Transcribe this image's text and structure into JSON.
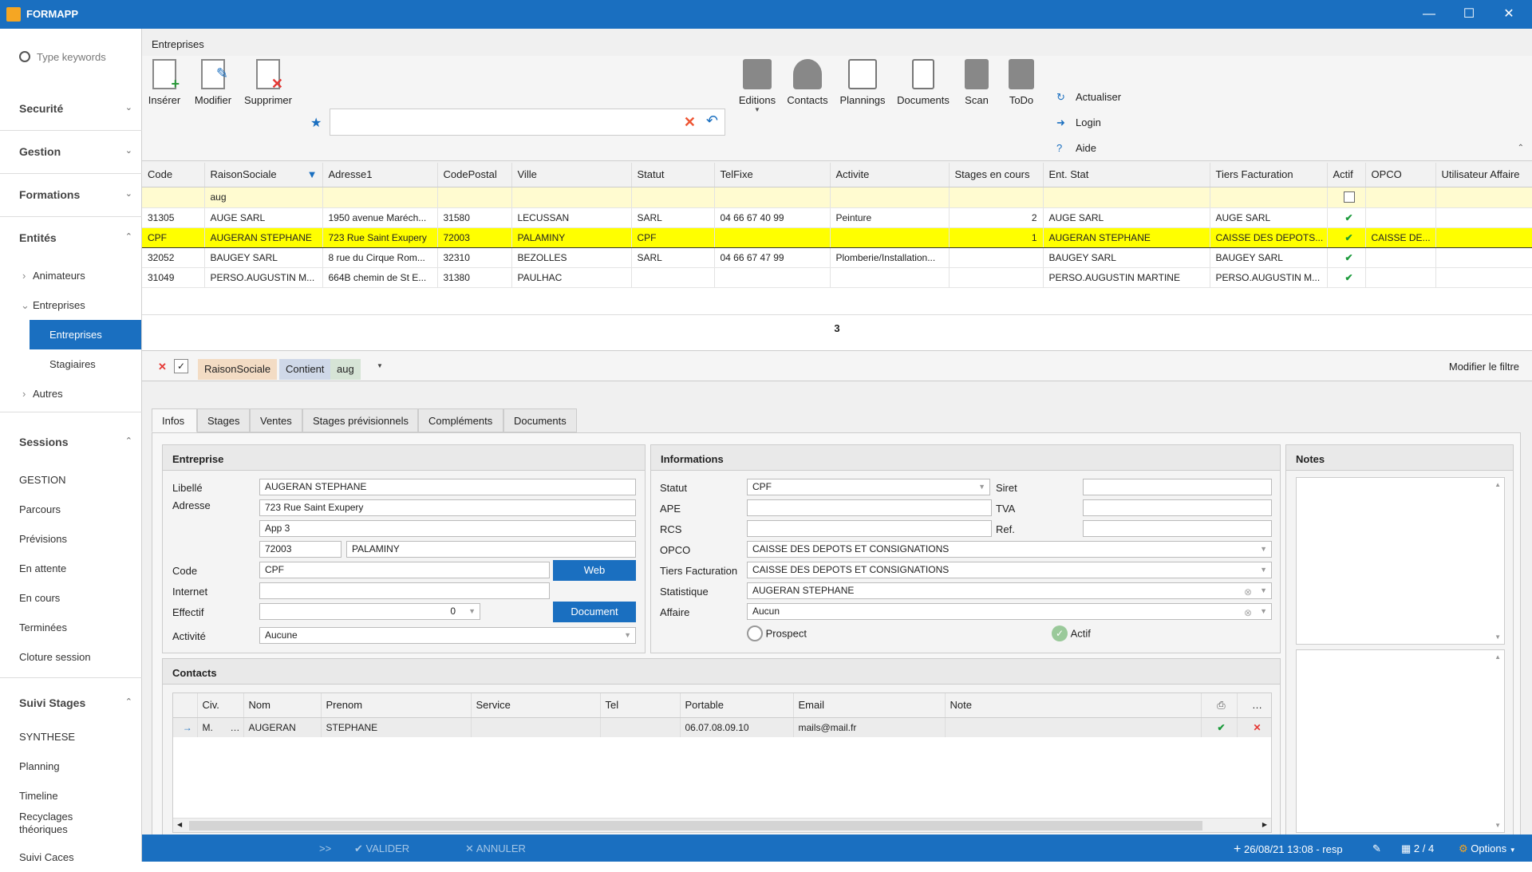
{
  "app": {
    "title": "FORMAPP"
  },
  "sidebar": {
    "search_placeholder": "Type keywords",
    "sections": {
      "securite": "Securité",
      "gestion": "Gestion",
      "formations": "Formations",
      "entites": "Entités",
      "sessions": "Sessions",
      "suivi": "Suivi Stages"
    },
    "entites_items": {
      "animateurs": "Animateurs",
      "entreprises": "Entreprises",
      "entreprises_sub": "Entreprises",
      "stagiaires": "Stagiaires",
      "autres": "Autres"
    },
    "sessions_items": [
      "GESTION",
      "Parcours",
      "Prévisions",
      "En attente",
      "En cours",
      "Terminées",
      "Cloture session"
    ],
    "suivi_items": [
      "SYNTHESE",
      "Planning",
      "Timeline",
      "Recyclages théoriques",
      "Suivi Caces"
    ]
  },
  "breadcrumb": "Entreprises",
  "ribbon": {
    "inserer": "Insérer",
    "modifier": "Modifier",
    "supprimer": "Supprimer",
    "search_value": "",
    "editions": "Editions",
    "contacts": "Contacts",
    "plannings": "Plannings",
    "documents": "Documents",
    "scan": "Scan",
    "todo": "ToDo",
    "actualiser": "Actualiser",
    "login": "Login",
    "aide": "Aide"
  },
  "grid": {
    "columns": [
      "Code",
      "RaisonSociale",
      "Adresse1",
      "CodePostal",
      "Ville",
      "Statut",
      "TelFixe",
      "Activite",
      "Stages en cours",
      "Ent. Stat",
      "Tiers Facturation",
      "Actif",
      "OPCO",
      "Utilisateur Affaire"
    ],
    "filter_value": "aug",
    "rows": [
      {
        "code": "31305",
        "raison": "AUGE SARL",
        "adresse": "1950 avenue Maréch...",
        "cp": "31580",
        "ville": "LECUSSAN",
        "statut": "SARL",
        "tel": "04 66 67 40 99",
        "activite": "Peinture",
        "stages": "2",
        "entstat": "AUGE SARL",
        "tiers": "AUGE SARL",
        "opco": "",
        "util": ""
      },
      {
        "code": "CPF",
        "raison": "AUGERAN STEPHANE",
        "adresse": "723 Rue Saint Exupery",
        "cp": "72003",
        "ville": "PALAMINY",
        "statut": "CPF",
        "tel": "",
        "activite": "",
        "stages": "1",
        "entstat": "AUGERAN STEPHANE",
        "tiers": "CAISSE DES DEPOTS...",
        "opco": "CAISSE DE...",
        "util": ""
      },
      {
        "code": "32052",
        "raison": "BAUGEY SARL",
        "adresse": "8 rue du Cirque Rom...",
        "cp": "32310",
        "ville": "BEZOLLES",
        "statut": "SARL",
        "tel": "04 66 67 47 99",
        "activite": "Plomberie/Installation...",
        "stages": "",
        "entstat": "BAUGEY SARL",
        "tiers": "BAUGEY SARL",
        "opco": "",
        "util": ""
      },
      {
        "code": "31049",
        "raison": "PERSO.AUGUSTIN M...",
        "adresse": "664B chemin de St E...",
        "cp": "31380",
        "ville": "PAULHAC",
        "statut": "",
        "tel": "",
        "activite": "",
        "stages": "",
        "entstat": "PERSO.AUGUSTIN MARTINE",
        "tiers": "PERSO.AUGUSTIN M...",
        "opco": "",
        "util": ""
      }
    ],
    "count": "3"
  },
  "filterbar": {
    "field": "RaisonSociale",
    "op": "Contient",
    "value": "aug",
    "modify": "Modifier le filtre"
  },
  "tabs": [
    "Infos",
    "Stages",
    "Ventes",
    "Stages prévisionnels",
    "Compléments",
    "Documents"
  ],
  "entreprise": {
    "title": "Entreprise",
    "labels": {
      "libelle": "Libellé",
      "adresse": "Adresse",
      "code": "Code",
      "internet": "Internet",
      "effectif": "Effectif",
      "activite": "Activité"
    },
    "libelle": "AUGERAN STEPHANE",
    "adresse1": "723 Rue Saint Exupery",
    "adresse2": "App 3",
    "cp": "72003",
    "ville": "PALAMINY",
    "code": "CPF",
    "internet": "",
    "effectif": "0",
    "activite": "Aucune",
    "web_btn": "Web",
    "doc_btn": "Document"
  },
  "informations": {
    "title": "Informations",
    "labels": {
      "statut": "Statut",
      "ape": "APE",
      "rcs": "RCS",
      "opco": "OPCO",
      "tiers": "Tiers Facturation",
      "statistique": "Statistique",
      "affaire": "Affaire",
      "siret": "Siret",
      "tva": "TVA",
      "ref": "Ref."
    },
    "statut": "CPF",
    "ape": "",
    "rcs": "",
    "opco": "CAISSE DES DEPOTS ET CONSIGNATIONS",
    "tiers": "CAISSE DES DEPOTS ET CONSIGNATIONS",
    "statistique": "AUGERAN STEPHANE",
    "affaire": "Aucun",
    "prospect": "Prospect",
    "actif": "Actif"
  },
  "notes": {
    "title": "Notes"
  },
  "contacts": {
    "title": "Contacts",
    "columns": [
      "Civ.",
      "Nom",
      "Prenom",
      "Service",
      "Tel",
      "Portable",
      "Email",
      "Note"
    ],
    "row": {
      "civ": "M.",
      "nom": "AUGERAN",
      "prenom": "STEPHANE",
      "service": "",
      "tel": "",
      "portable": "06.07.08.09.10",
      "email": "mails@mail.fr",
      "note": ""
    }
  },
  "statusbar": {
    "valider": "VALIDER",
    "annuler": "ANNULER",
    "datetime": "26/08/21 13:08 - resp",
    "pages": "2 / 4",
    "options": "Options"
  },
  "colors": {
    "accent": "#1a6fc0",
    "selected_row": "#ffff00",
    "filter_row": "#fffbd0",
    "check": "#1a9a3a",
    "delete": "#e53935"
  }
}
